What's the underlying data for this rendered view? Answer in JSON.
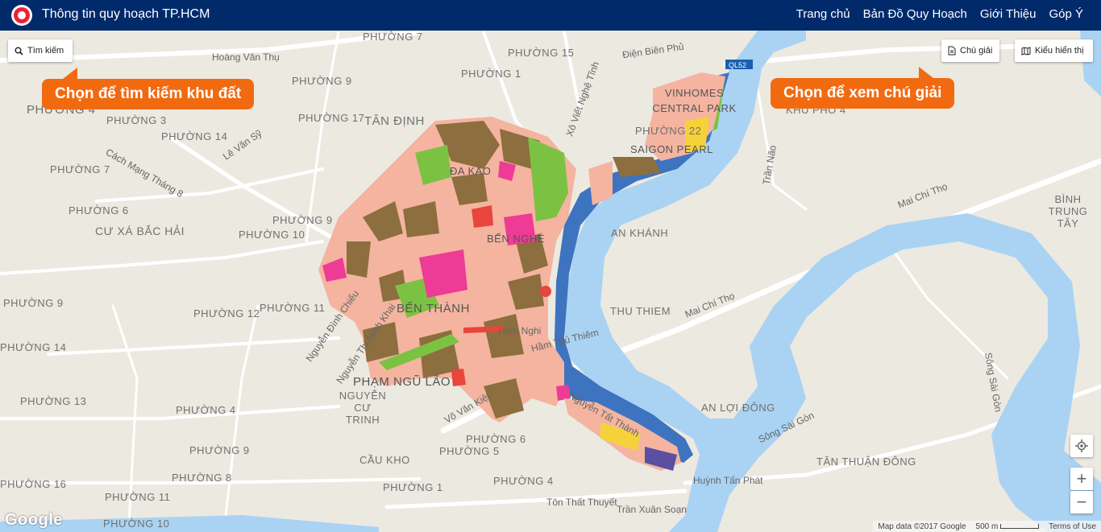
{
  "header": {
    "title": "Thông tin quy hoạch TP.HCM",
    "nav": [
      "Trang chủ",
      "Bản Đồ Quy Hoạch",
      "Giới Thiệu",
      "Góp Ý"
    ]
  },
  "controls": {
    "search_label": "Tìm kiếm",
    "legend_label": "Chú giải",
    "view_label": "Kiểu hiển thị",
    "zoom_in": "+",
    "zoom_out": "−"
  },
  "callouts": {
    "search": "Chọn để tìm kiếm khu đất",
    "legend": "Chọn để xem chú giải"
  },
  "map_labels": {
    "phuong7": "PHƯỜNG 7",
    "phuong15": "PHƯỜNG 15",
    "phuong1_top": "PHƯỜNG 1",
    "phuong4_left": "PHƯỜNG 4",
    "phuong3": "PHƯỜNG 3",
    "phuong14": "PHƯỜNG 14",
    "phuong17": "PHƯỜNG 17",
    "tan_dinh": "TÂN ĐỊNH",
    "phuong7_left": "PHƯỜNG 7",
    "phuong6_left": "PHƯỜNG 6",
    "phuong9_mid": "PHƯỜNG 9",
    "phuong10": "PHƯỜNG 10",
    "cu_xa": "CƯ XÁ BẮC HẢI",
    "phuong9_left": "PHƯỜNG 9",
    "phuong12": "PHƯỜNG 12",
    "phuong11": "PHƯỜNG 11",
    "phuong14_left": "PHƯỜNG 14",
    "phuong13": "PHƯỜNG 13",
    "phuong4_mid": "PHƯỜNG 4",
    "phuong9_low": "PHƯỜNG 9",
    "phuong8": "PHƯỜNG 8",
    "phuong16": "PHƯỜNG 16",
    "phuong11_low": "PHƯỜNG 11",
    "phuong10_low": "PHƯỜNG 10",
    "phuong6": "PHƯỜNG 6",
    "phuong5": "PHƯỜNG 5",
    "phuong1_low": "PHƯỜNG 1",
    "phuong4_low": "PHƯỜNG 4",
    "cau_kho": "CẦU KHO",
    "pham_ngu_lao": "PHẠM NGŨ LÃO",
    "nguyen_cu_trinh": "NGUYỄN CƯ TRINH",
    "ben_thanh": "BẾN THÀNH",
    "ben_nghe": "BẾN NGHÉ",
    "da_kao": "ĐA KAO",
    "an_khanh": "AN KHÁNH",
    "thu_thiem": "THU THIEM",
    "an_loi_dong": "AN LỢI ĐÔNG",
    "tan_thuan_dong": "TÂN THUẬN ĐÔNG",
    "binh_trung_tay": "BÌNH TRUNG TÂY",
    "khu_pho_4": "KHU PHỐ 4",
    "vinhomes": "VINHOMES CENTRAL PARK",
    "phuong22": "PHƯỜNG 22",
    "saigon_pearl": "SAIGON PEARL",
    "mai_chi_tho_1": "Mai Chí Thọ",
    "mai_chi_tho_2": "Mai Chí Thọ",
    "dien_bien_phu": "Điện Biên Phủ",
    "ham_thu_thiem": "Hầm Thủ Thiêm",
    "ham_nghi": "Hàm Nghi",
    "vo_van_kiet": "Võ Văn Kiệt",
    "song_sai_gon": "Sông Sài Gòn",
    "song_sai_gon_2": "Sông Sài Gòn",
    "huynh_tan_phat": "Huỳnh Tấn Phát",
    "tran_xuan_soan": "Trần Xuân Soạn",
    "ton_that_thuyet": "Tôn Thất Thuyết",
    "nguyen_tat_thanh": "Nguyễn Tất Thành",
    "hoang_van_thu": "Hoàng Văn Thụ",
    "cach_mang_thang_8": "Cách Mạng Tháng 8",
    "ql52": "QL52",
    "xo_viet_nghe_tinh": "Xô Viết Nghệ Tĩnh",
    "le_van_sy": "Lê Văn Sỹ",
    "tran_nao": "Trần Não",
    "nguyen_thi_minh_khai": "Nguyễn Thị Minh Khai",
    "nguyen_dinh_chieu": "Nguyễn Đình Chiểu"
  },
  "attribution": {
    "map_data": "Map data ©2017 Google",
    "scale": "500 m",
    "terms": "Terms of Use",
    "google": "Google"
  },
  "colors": {
    "header": "#012a6b",
    "callout": "#f26a10",
    "river": "#aad3f3",
    "river_planned": "#3d73bf",
    "residential": "#f4b4a0",
    "mixed": "#8d6e3e",
    "green": "#7cc242",
    "commercial": "#ee3b95"
  }
}
